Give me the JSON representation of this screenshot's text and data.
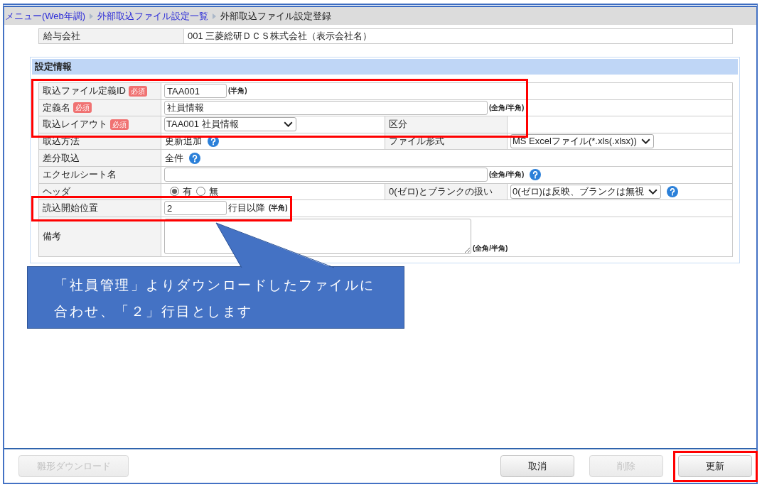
{
  "breadcrumb": [
    {
      "label": "メニュー(Web年調)",
      "kind": "link"
    },
    {
      "label": "外部取込ファイル設定一覧",
      "kind": "link"
    },
    {
      "label": "外部取込ファイル設定登録",
      "kind": "current"
    }
  ],
  "company": {
    "label": "給与会社",
    "value": "001 三菱総研ＤＣＳ株式会社（表示会社名）"
  },
  "settings": {
    "title": "設定情報",
    "rows": [
      {
        "label": "取込ファイル定義ID",
        "badge": "必須",
        "highlighted": true,
        "field": {
          "kind": "input",
          "wide": false,
          "value": "TAA001",
          "note": "(半角)"
        }
      },
      {
        "label": "定義名",
        "badge": "必須",
        "highlighted": true,
        "field": {
          "kind": "input",
          "wide": true,
          "value": "社員情報",
          "note": "(全角/半角)"
        }
      },
      {
        "label": "取込レイアウト",
        "badge": "必須",
        "highlighted": true,
        "field": {
          "kind": "select",
          "value": "TAA001 社員情報"
        },
        "pair": {
          "label": "区分"
        }
      },
      {
        "label": "取込方法",
        "highlighted": false,
        "field": {
          "kind": "static",
          "value": "更新追加",
          "help": true
        },
        "pair": {
          "label": "ファイル形式",
          "field": {
            "kind": "select",
            "value": "MS Excelファイル(*.xls(.xlsx))"
          }
        }
      },
      {
        "label": "差分取込",
        "highlighted": false,
        "field": {
          "kind": "static",
          "value": "全件",
          "help": true
        }
      },
      {
        "label": "エクセルシート名",
        "highlighted": false,
        "field": {
          "kind": "input",
          "wide": true,
          "note": "(全角/半角)",
          "help": true
        }
      },
      {
        "label": "ヘッダ",
        "highlighted": false,
        "field": {
          "kind": "radio",
          "options": [
            {
              "label": "有",
              "selected": true
            },
            {
              "label": "無",
              "selected": false
            }
          ]
        },
        "pair": {
          "label": "0(ゼロ)とブランクの扱い",
          "field": {
            "kind": "select",
            "value": "0(ゼロ)は反映、ブランクは無視",
            "help": true
          }
        }
      },
      {
        "label": "読込開始位置",
        "highlighted": true,
        "field": {
          "kind": "input",
          "wide": false,
          "value": "2",
          "suffix": "行目以降",
          "note": "(半角)"
        }
      },
      {
        "label": "備考",
        "highlighted": false,
        "field": {
          "kind": "textarea",
          "note": "(全角/半角)"
        }
      }
    ]
  },
  "callout": {
    "text": "「社員管理」よりダウンロードしたファイルに合わせ、「２」行目とします"
  },
  "footer": {
    "left": [
      {
        "label": "雛形ダウンロード",
        "disabled": true,
        "highlighted": false
      }
    ],
    "right": [
      {
        "label": "取消",
        "disabled": false,
        "highlighted": false
      },
      {
        "label": "削除",
        "disabled": true,
        "highlighted": false
      },
      {
        "label": "更新",
        "disabled": false,
        "highlighted": true
      }
    ]
  }
}
